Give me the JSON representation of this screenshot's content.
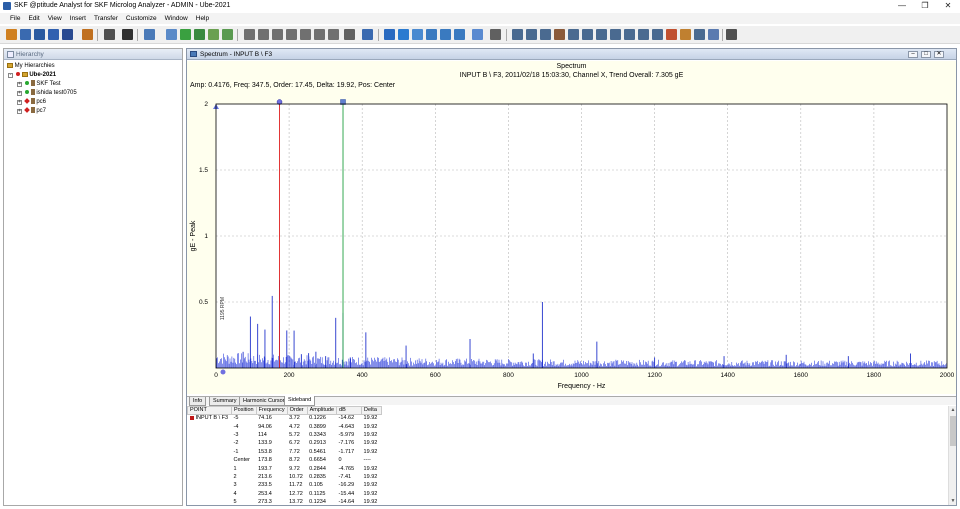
{
  "window": {
    "title": "SKF @ptitude Analyst for SKF Microlog Analyzer - ADMIN - Ube-2021",
    "minimize": "—",
    "restore": "❐",
    "close": "✕"
  },
  "menu": [
    "File",
    "Edit",
    "View",
    "Insert",
    "Transfer",
    "Customize",
    "Window",
    "Help"
  ],
  "hierarchy": {
    "header": "Hierarchy",
    "root": "My Hierarchies",
    "items": [
      {
        "label": "Ube-2021",
        "level": 1,
        "expander": "-"
      },
      {
        "label": "SKF Test",
        "level": 2,
        "expander": "+"
      },
      {
        "label": "ishida test0705",
        "level": 2,
        "expander": "+"
      },
      {
        "label": "pc6",
        "level": 2,
        "expander": "+"
      },
      {
        "label": "pc7",
        "level": 2,
        "expander": "+"
      }
    ]
  },
  "spectrum": {
    "window_title": "Spectrum - INPUT B \\ F3",
    "ctrl_min": "–",
    "ctrl_max": "□",
    "ctrl_close": "✕",
    "title": "Spectrum",
    "subtitle": "INPUT B \\ F3, 2011/02/18 15:03:30, Channel X, Trend Overall: 7.305 gE",
    "readout": "Amp: 0.4176, Freq: 347.5, Order: 17.45, Delta: 19.92, Pos: Center"
  },
  "chart_data": {
    "type": "line",
    "xlabel": "Frequency - Hz",
    "ylabel": "gE - Peak",
    "xlim": [
      0,
      2000
    ],
    "ylim": [
      0,
      2
    ],
    "xticks": [
      0,
      200,
      400,
      600,
      800,
      1000,
      1200,
      1400,
      1600,
      1800,
      2000
    ],
    "yticks": [
      0.5,
      1,
      1.5,
      2
    ],
    "grid": true,
    "rpm_annotation": "1195 RPM",
    "cursors": [
      {
        "name": "Harmonic",
        "freq": 173.8,
        "color": "#e02020"
      },
      {
        "name": "Sideband",
        "freq": 347.5,
        "color": "#20a040"
      }
    ],
    "peaks": [
      {
        "freq": 74.16,
        "amp": 0.1226
      },
      {
        "freq": 94.06,
        "amp": 0.3899
      },
      {
        "freq": 114.0,
        "amp": 0.3343
      },
      {
        "freq": 133.9,
        "amp": 0.2913
      },
      {
        "freq": 153.8,
        "amp": 0.5461
      },
      {
        "freq": 173.8,
        "amp": 0.6654
      },
      {
        "freq": 193.7,
        "amp": 0.2844
      },
      {
        "freq": 213.6,
        "amp": 0.2835
      },
      {
        "freq": 233.5,
        "amp": 0.105
      },
      {
        "freq": 253.4,
        "amp": 0.1125
      },
      {
        "freq": 273.3,
        "amp": 0.1234
      },
      {
        "freq": 300,
        "amp": 0.09
      },
      {
        "freq": 327.6,
        "amp": 0.38
      },
      {
        "freq": 347.5,
        "amp": 0.4176
      },
      {
        "freq": 367.4,
        "amp": 0.08
      },
      {
        "freq": 410,
        "amp": 0.27
      },
      {
        "freq": 520,
        "amp": 0.17
      },
      {
        "freq": 695,
        "amp": 0.22
      },
      {
        "freq": 868,
        "amp": 0.11
      },
      {
        "freq": 893,
        "amp": 0.5
      },
      {
        "freq": 1042,
        "amp": 0.2
      },
      {
        "freq": 1200,
        "amp": 0.08
      },
      {
        "freq": 1390,
        "amp": 0.09
      },
      {
        "freq": 1560,
        "amp": 0.1
      },
      {
        "freq": 1730,
        "amp": 0.09
      },
      {
        "freq": 1900,
        "amp": 0.11
      }
    ],
    "noise_floor": 0.04
  },
  "tabs": [
    "Info",
    "Summary",
    "Harmonic Cursor",
    "Sideband"
  ],
  "table": {
    "columns": [
      "POINT",
      "Position",
      "Frequency",
      "Order",
      "Amplitude",
      "dB",
      "Delta"
    ],
    "point": "INPUT B \\ F3",
    "rows": [
      [
        "-5",
        "74.16",
        "3.72",
        "0.1226",
        "-14.62",
        "19.92"
      ],
      [
        "-4",
        "94.06",
        "4.72",
        "0.3899",
        "-4.643",
        "19.92"
      ],
      [
        "-3",
        "114",
        "5.72",
        "0.3343",
        "-5.979",
        "19.92"
      ],
      [
        "-2",
        "133.9",
        "6.72",
        "0.2913",
        "-7.176",
        "19.92"
      ],
      [
        "-1",
        "153.8",
        "7.72",
        "0.5461",
        "-1.717",
        "19.92"
      ],
      [
        "Center",
        "173.8",
        "8.72",
        "0.6654",
        "0",
        "----"
      ],
      [
        "1",
        "193.7",
        "9.72",
        "0.2844",
        "-4.765",
        "19.92"
      ],
      [
        "2",
        "213.6",
        "10.72",
        "0.2835",
        "-7.41",
        "19.92"
      ],
      [
        "3",
        "233.5",
        "11.72",
        "0.105",
        "-16.29",
        "19.92"
      ],
      [
        "4",
        "253.4",
        "12.72",
        "0.1125",
        "-15.44",
        "19.92"
      ],
      [
        "5",
        "273.3",
        "13.72",
        "0.1234",
        "-14.64",
        "19.92"
      ]
    ]
  }
}
